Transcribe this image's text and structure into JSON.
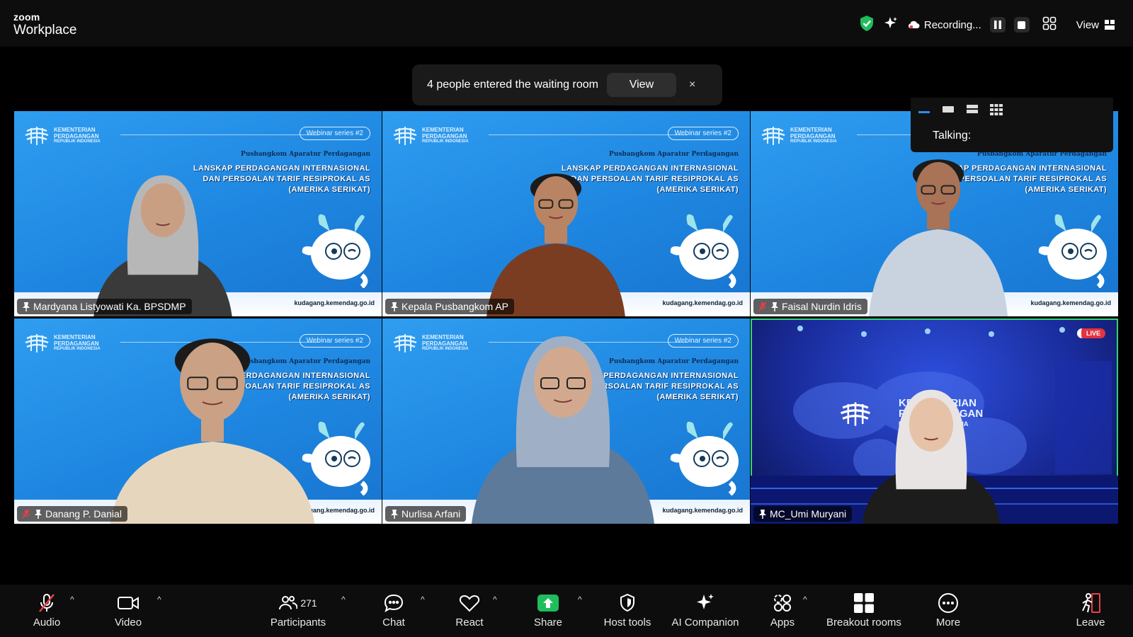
{
  "app": {
    "brand_small": "zoom",
    "brand": "Workplace"
  },
  "topbar": {
    "recording_label": "Recording...",
    "view_label": "View"
  },
  "banner": {
    "message": "4 people entered the waiting room",
    "view_button": "View",
    "close": "×"
  },
  "view_popup": {
    "talking_label": "Talking:"
  },
  "slide": {
    "ministry": [
      "KEMENTERIAN",
      "PERDAGANGAN",
      "REPUBLIK INDONESIA"
    ],
    "series": "Webinar series #2",
    "subheading": "Pusbangkom Aparatur Perdagangan",
    "headline": [
      "LANSKAP PERDAGANGAN INTERNASIONAL",
      "DAN PERSOALAN TARIF RESIPROKAL AS",
      "(AMERIKA SERIKAT)"
    ],
    "site": "kudagang.kemendag.go.id"
  },
  "studio": {
    "live_badge": "LIVE",
    "title_line1": "KEMENTERIAN",
    "title_line2": "PERDAGANGAN",
    "title_line3": "REPUBLIK INDONESIA"
  },
  "participants": [
    {
      "name": "Mardyana Listyowati Ka. BPSDMP",
      "muted": false
    },
    {
      "name": "Kepala Pusbangkom AP",
      "muted": false
    },
    {
      "name": "Faisal Nurdin Idris",
      "muted": true
    },
    {
      "name": "Danang P. Danial",
      "muted": true
    },
    {
      "name": "Nurlisa Arfani",
      "muted": false
    },
    {
      "name": "MC_Umi Muryani",
      "muted": false,
      "active": true
    }
  ],
  "toolbar": {
    "audio": "Audio",
    "video": "Video",
    "participants": "Participants",
    "participant_count": "271",
    "chat": "Chat",
    "react": "React",
    "share": "Share",
    "host_tools": "Host tools",
    "ai_companion": "AI Companion",
    "apps": "Apps",
    "breakout_rooms": "Breakout rooms",
    "more": "More",
    "leave": "Leave"
  },
  "colors": {
    "active_speaker": "#35d27a",
    "share_green": "#1fbd5c",
    "shield_green": "#1fbd5c",
    "leave_red": "#e5404a",
    "slide_blue": "#2f9df0"
  }
}
